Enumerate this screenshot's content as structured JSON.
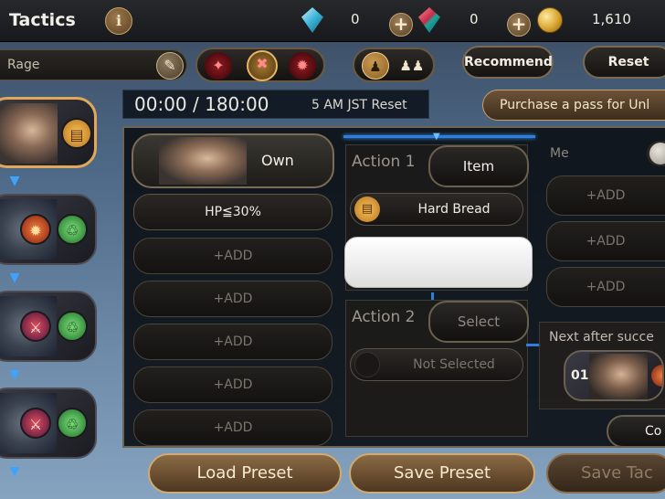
{
  "header": {
    "title": "Tactics",
    "info_icon": "i",
    "currencies": [
      {
        "icon": "blue-crystal-icon",
        "value": "0"
      },
      {
        "icon": "red-crystal-icon",
        "value": "0"
      },
      {
        "icon": "gold-coin-icon",
        "value": "1,610"
      }
    ],
    "plus": "+"
  },
  "toolbar": {
    "rage_label": "Rage",
    "recommend_label": "Recommend",
    "reset_label": "Reset",
    "skills": [
      "rage-skill-1-icon",
      "rage-skill-2-icon",
      "rage-skill-3-icon"
    ],
    "modes": [
      "single-person-icon",
      "group-icon"
    ]
  },
  "timer": {
    "value": "00:00 / 180:00",
    "reset_note": "5 AM JST Reset"
  },
  "pass_button": "Purchase a pass for Unl",
  "conditions": {
    "own_label": "Own",
    "rows": [
      "HP≦30%",
      "+ADD",
      "+ADD",
      "+ADD",
      "+ADD",
      "+ADD"
    ]
  },
  "actions": {
    "action1_label": "Action 1",
    "action1_button": "Item",
    "action1_item": "Hard Bread",
    "action2_label": "Action 2",
    "action2_button": "Select",
    "action2_item": "Not Selected"
  },
  "targets": {
    "me_label": "Me",
    "rows": [
      "+ADD",
      "+ADD",
      "+ADD"
    ],
    "next_label": "Next after succe",
    "next_number": "01",
    "copy_label": "Co"
  },
  "bottom": {
    "load": "Load Preset",
    "save": "Save Preset",
    "save_tactics": "Save Tac"
  },
  "colors": {
    "accent_gold": "#c9a06a",
    "link_blue": "#2e7ee0",
    "panel_dark": "#0c1016"
  }
}
